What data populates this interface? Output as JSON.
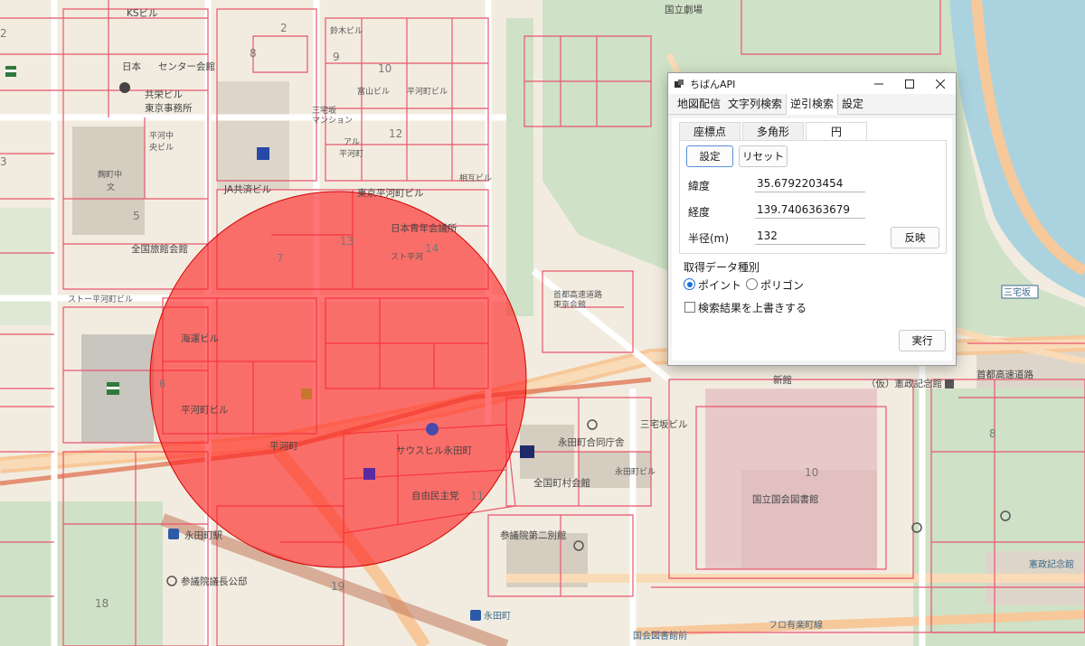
{
  "window": {
    "title": "ちばんAPI",
    "icon": "app-icon",
    "controls": [
      "minimize-icon",
      "maximize-icon",
      "close-icon"
    ]
  },
  "tabs": [
    "地図配信",
    "文字列検索",
    "逆引検索",
    "設定"
  ],
  "active_tab": "逆引検索",
  "subtabs": [
    "座標点",
    "多角形",
    "円"
  ],
  "active_subtab": "円",
  "circle_panel": {
    "set_button": "設定",
    "reset_button": "リセット",
    "latitude_label": "緯度",
    "latitude_value": "35.6792203454",
    "longitude_label": "経度",
    "longitude_value": "139.7406363679",
    "radius_label": "半径(m)",
    "radius_value": "132",
    "apply_button": "反映"
  },
  "data_type": {
    "label": "取得データ種別",
    "options": [
      "ポイント",
      "ポリゴン"
    ],
    "selected": "ポイント"
  },
  "overwrite_checkbox": {
    "label": "検索結果を上書きする",
    "checked": false
  },
  "run_button": "実行",
  "map": {
    "colors": {
      "parcel": "#e8566d",
      "circle": "#ff2020",
      "water": "#aad3df",
      "park": "#cde3c4",
      "rail": "#e07a5a"
    },
    "labels": [
      "KSビル",
      "日本",
      "センター会館",
      "共栄ビル",
      "東京事務所",
      "平河中",
      "央ビル",
      "麹町中",
      "文",
      "JA共済ビル",
      "アル",
      "平河町",
      "三宅坂",
      "マンション",
      "鈴木ビル",
      "富山ビル",
      "平河町ビル",
      "東京平河町ビル",
      "日本青年会議所",
      "スト平河",
      "相互ビル",
      "全国旅館会館",
      "ストー平河町ビル",
      "海運ビル",
      "平河町ビル",
      "平河町",
      "サウスヒル永田町",
      "自由民主党",
      "永田町合同庁舎",
      "全国町村会館",
      "参議院第二別館",
      "永田町駅",
      "参議院議長公邸",
      "首都高速道路",
      "東京会館",
      "三宅坂",
      "新館",
      "（仮）憲政記念館",
      "国立国会図書館",
      "首都高速道路",
      "国立劇場",
      "憲政記念館",
      "国会図書館前",
      "永田町",
      "三宅坂ビル",
      "フロ有楽町線",
      "永田町ビル"
    ],
    "block_numbers": [
      "8",
      "9",
      "10",
      "12",
      "2",
      "3",
      "5",
      "7",
      "13",
      "14",
      "6",
      "11",
      "10",
      "8",
      "18",
      "19",
      "2"
    ]
  }
}
